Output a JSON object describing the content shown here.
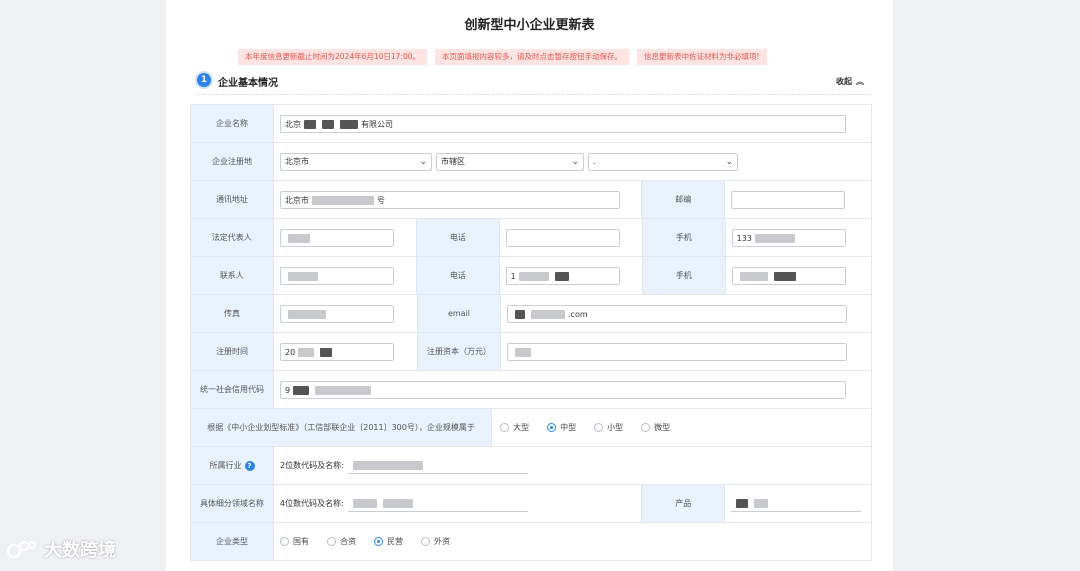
{
  "page": {
    "title": "创新型中小企业更新表",
    "notices": [
      "本年度信息更新截止时间为2024年6月10日17:00。",
      "本页面填报内容较多，请及时点击暂存按钮手动保存。",
      "信息更新表中佐证材料为非必填项!"
    ]
  },
  "section": {
    "number": "1",
    "title": "企业基本情况",
    "collapse_label": "收起"
  },
  "form": {
    "company_name": {
      "label": "企业名称",
      "value_prefix": "北京",
      "value_suffix": "有限公司"
    },
    "registered_place": {
      "label": "企业注册地",
      "province": "北京市",
      "district": "市辖区",
      "county": "."
    },
    "address": {
      "label": "通讯地址",
      "value_prefix": "北京市",
      "value_suffix": "号"
    },
    "postcode": {
      "label": "邮编",
      "value": ""
    },
    "legal_rep": {
      "label": "法定代表人",
      "value": ""
    },
    "legal_phone": {
      "label": "电话",
      "value": ""
    },
    "legal_mobile": {
      "label": "手机",
      "value": "133"
    },
    "contact": {
      "label": "联系人",
      "value": ""
    },
    "contact_phone": {
      "label": "电话",
      "value": "1"
    },
    "contact_mobile": {
      "label": "手机",
      "value": ""
    },
    "fax": {
      "label": "传真",
      "value": ""
    },
    "email": {
      "label": "email",
      "value_suffix": ".com"
    },
    "reg_date": {
      "label": "注册时间",
      "value": "20"
    },
    "reg_capital": {
      "label": "注册资本（万元）",
      "value": ""
    },
    "credit_code": {
      "label": "统一社会信用代码",
      "value": "9"
    },
    "scale": {
      "label": "根据《中小企业划型标准》（工信部联企业〔2011〕300号），企业规模属于",
      "options": [
        "大型",
        "中型",
        "小型",
        "微型"
      ],
      "selected": "中型"
    },
    "industry": {
      "label": "所属行业",
      "prefix": "2位数代码及名称:"
    },
    "subfield": {
      "label": "具体细分领域名称",
      "prefix": "4位数代码及名称:"
    },
    "product": {
      "label": "产品",
      "value": ""
    },
    "company_type": {
      "label": "企业类型",
      "options": [
        "国有",
        "合资",
        "民营",
        "外资"
      ],
      "selected": "民营"
    }
  },
  "watermark": {
    "text": "大数跨境"
  },
  "colors": {
    "accent": "#2b84ea",
    "label_bg": "#e9f2fc",
    "notice_bg": "#fde3e2",
    "notice_text": "#e2574c"
  }
}
